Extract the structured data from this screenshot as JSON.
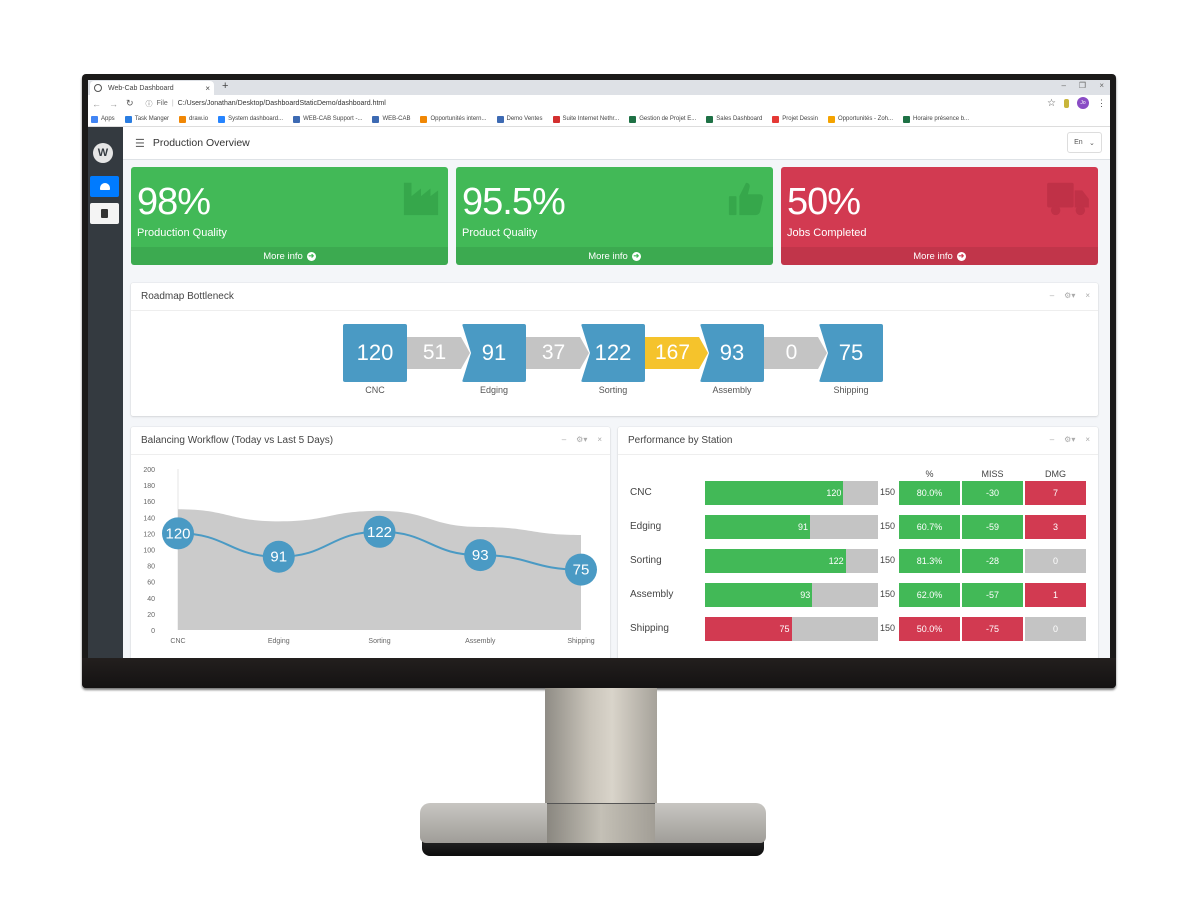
{
  "browser": {
    "tab_title": "Web-Cab Dashboard",
    "new_tab": "+",
    "url_scheme": "File",
    "url": "C:/Users/Jonathan/Desktop/DashboardStaticDemo/dashboard.html",
    "profile_initials": "Jo",
    "bookmarks": [
      {
        "label": "Apps",
        "color": "#4285f4"
      },
      {
        "label": "Task Manger",
        "color": "#2a7de1"
      },
      {
        "label": "draw.io",
        "color": "#f08705"
      },
      {
        "label": "System dashboard...",
        "color": "#2684ff"
      },
      {
        "label": "WEB-CAB Support -...",
        "color": "#3d6ab3"
      },
      {
        "label": "WEB-CAB",
        "color": "#3d6ab3"
      },
      {
        "label": "Opportunités intern...",
        "color": "#f08705"
      },
      {
        "label": "Demo Ventes",
        "color": "#3d6ab3"
      },
      {
        "label": "Suite Internet Nethr...",
        "color": "#d32f2f"
      },
      {
        "label": "Gestion de Projet E...",
        "color": "#1e7145"
      },
      {
        "label": "Sales Dashboard",
        "color": "#1e7145"
      },
      {
        "label": "Projet Dessin",
        "color": "#e53935"
      },
      {
        "label": "Opportunités - Zoh...",
        "color": "#f4a300"
      },
      {
        "label": "Horaire présence b...",
        "color": "#1e7145"
      }
    ]
  },
  "app": {
    "logo_letter": "W",
    "page_title": "Production Overview",
    "language": "En",
    "sidebar": [
      {
        "icon": "dashboard-gauge-icon",
        "active": true
      },
      {
        "icon": "clipboard-icon",
        "active": false
      }
    ]
  },
  "info_boxes": [
    {
      "value": "98%",
      "label": "Production Quality",
      "footer": "More info",
      "icon": "factory-icon",
      "color": "#42b957"
    },
    {
      "value": "95.5%",
      "label": "Product Quality",
      "footer": "More info",
      "icon": "thumbs-up-icon",
      "color": "#42b957"
    },
    {
      "value": "50%",
      "label": "Jobs Completed",
      "footer": "More info",
      "icon": "truck-icon",
      "color": "#d23a51"
    }
  ],
  "roadmap": {
    "title": "Roadmap Bottleneck",
    "stations": [
      {
        "name": "CNC",
        "value": "120"
      },
      {
        "name": "Edging",
        "value": "91"
      },
      {
        "name": "Sorting",
        "value": "122"
      },
      {
        "name": "Assembly",
        "value": "93"
      },
      {
        "name": "Shipping",
        "value": "75"
      }
    ],
    "links": [
      {
        "value": "51",
        "status": "normal"
      },
      {
        "value": "37",
        "status": "normal"
      },
      {
        "value": "167",
        "status": "warning"
      },
      {
        "value": "0",
        "status": "normal"
      }
    ],
    "colors": {
      "station": "#4a9ac4",
      "link": "#c4c4c4",
      "warning": "#f5c32c"
    }
  },
  "chart_data": {
    "type": "area",
    "title": "Balancing Workflow (Today vs Last 5 Days)",
    "categories": [
      "CNC",
      "Edging",
      "Sorting",
      "Assembly",
      "Shipping"
    ],
    "series": [
      {
        "name": "Last 5 Days",
        "type": "area",
        "color": "#c8c8c8",
        "values": [
          150,
          135,
          148,
          128,
          118
        ]
      },
      {
        "name": "Today",
        "type": "line",
        "color": "#4a9ac4",
        "values": [
          120,
          91,
          122,
          93,
          75
        ]
      }
    ],
    "yticks": [
      0,
      20,
      40,
      60,
      80,
      100,
      120,
      140,
      160,
      180,
      200
    ],
    "ylim": [
      0,
      200
    ],
    "xlabel": "",
    "ylabel": "",
    "grid": false,
    "legend": "none"
  },
  "performance": {
    "title": "Performance by Station",
    "columns": [
      "%",
      "MISS",
      "DMG"
    ],
    "target": 150,
    "rows": [
      {
        "station": "CNC",
        "value": 120,
        "target": "150",
        "pct": "80.0%",
        "miss": "-30",
        "dmg": "7",
        "bar_status": "green",
        "pct_status": "green",
        "miss_status": "green",
        "dmg_status": "red"
      },
      {
        "station": "Edging",
        "value": 91,
        "target": "150",
        "pct": "60.7%",
        "miss": "-59",
        "dmg": "3",
        "bar_status": "green",
        "pct_status": "green",
        "miss_status": "green",
        "dmg_status": "red"
      },
      {
        "station": "Sorting",
        "value": 122,
        "target": "150",
        "pct": "81.3%",
        "miss": "-28",
        "dmg": "0",
        "bar_status": "green",
        "pct_status": "green",
        "miss_status": "green",
        "dmg_status": "gray"
      },
      {
        "station": "Assembly",
        "value": 93,
        "target": "150",
        "pct": "62.0%",
        "miss": "-57",
        "dmg": "1",
        "bar_status": "green",
        "pct_status": "green",
        "miss_status": "green",
        "dmg_status": "red"
      },
      {
        "station": "Shipping",
        "value": 75,
        "target": "150",
        "pct": "50.0%",
        "miss": "-75",
        "dmg": "0",
        "bar_status": "red",
        "pct_status": "red",
        "miss_status": "red",
        "dmg_status": "gray"
      }
    ]
  },
  "card_tools": {
    "minimize": "–",
    "settings": "⚙▾",
    "close": "×"
  },
  "more_info_arrow": "➜"
}
